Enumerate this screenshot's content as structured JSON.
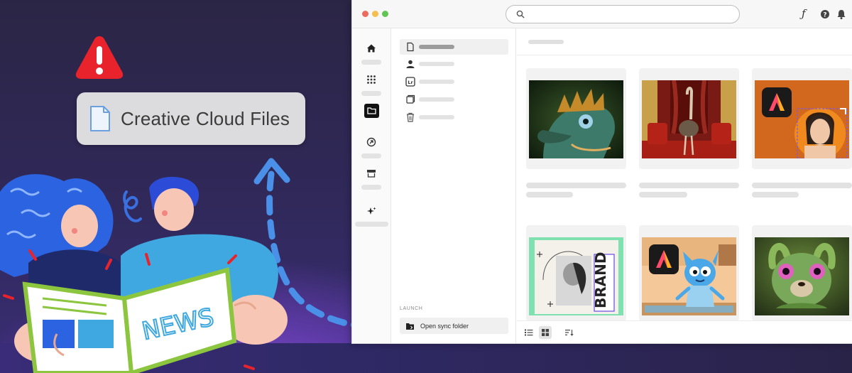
{
  "banner": {
    "warning_icon": "warning-triangle-icon",
    "file_chip_label": "Creative Cloud Files",
    "file_icon": "document-icon"
  },
  "window": {
    "search": {
      "placeholder": ""
    },
    "toolbar_icons": [
      "search-icon",
      "font-icon",
      "help-icon",
      "bell-icon"
    ],
    "rail_icons": [
      "home-icon",
      "apps-grid-icon",
      "files-folder-icon",
      "stock-icon",
      "marketplace-icon",
      "sparkle-icon"
    ],
    "nav_icons": [
      "file-icon",
      "person-icon",
      "lightroom-icon",
      "copy-icon",
      "trash-icon"
    ],
    "launch_label": "LAUNCH",
    "open_sync_folder": "Open sync folder",
    "footer_icons": [
      "list-view-icon",
      "grid-view-icon",
      "sort-icon"
    ],
    "thumbnails": [
      "dragon-creature-thumbnail",
      "ostrich-room-thumbnail",
      "adobe-express-portrait-thumbnail",
      "brand-collage-thumbnail",
      "blue-cartoon-character-thumbnail",
      "green-creature-thumbnail"
    ],
    "adobe_express_logo_color": "#1a1a1a"
  },
  "colors": {
    "warning_red": "#e8232b",
    "background_purple": "#2a2443",
    "arrow_blue": "#4a8fe8"
  }
}
